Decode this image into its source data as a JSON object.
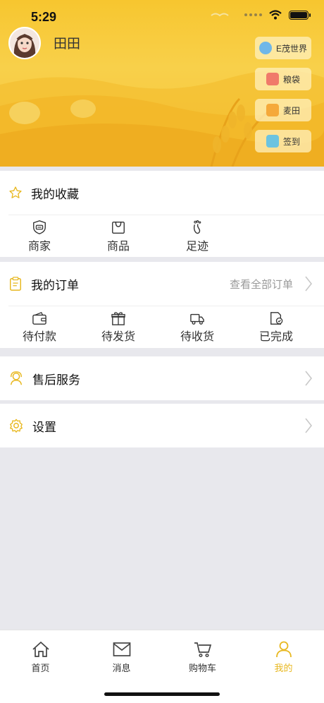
{
  "status": {
    "time": "5:29"
  },
  "profile": {
    "name": "田田"
  },
  "side_buttons": [
    {
      "label": "E茂世界",
      "icon": "globe-icon",
      "color": "#6fb7e8"
    },
    {
      "label": "粮袋",
      "icon": "shop-icon",
      "color": "#f07a6a"
    },
    {
      "label": "麦田",
      "icon": "people-icon",
      "color": "#f5a93a"
    },
    {
      "label": "签到",
      "icon": "calendar-icon",
      "color": "#6cc3e0"
    }
  ],
  "favorites": {
    "title": "我的收藏",
    "items": [
      {
        "label": "商家",
        "icon": "store-icon"
      },
      {
        "label": "商品",
        "icon": "bag-icon"
      },
      {
        "label": "足迹",
        "icon": "footprint-icon"
      }
    ]
  },
  "orders": {
    "title": "我的订单",
    "view_all": "查看全部订单",
    "items": [
      {
        "label": "待付款",
        "icon": "wallet-icon"
      },
      {
        "label": "待发货",
        "icon": "gift-icon"
      },
      {
        "label": "待收货",
        "icon": "truck-icon"
      },
      {
        "label": "已完成",
        "icon": "done-doc-icon"
      }
    ]
  },
  "after_sales": {
    "title": "售后服务"
  },
  "settings": {
    "title": "设置"
  },
  "accent_color": "#e8b820",
  "tabbar": {
    "tabs": [
      {
        "label": "首页",
        "icon": "home-icon"
      },
      {
        "label": "消息",
        "icon": "mail-icon"
      },
      {
        "label": "购物车",
        "icon": "cart-icon"
      },
      {
        "label": "我的",
        "icon": "person-icon",
        "active": true
      }
    ]
  }
}
